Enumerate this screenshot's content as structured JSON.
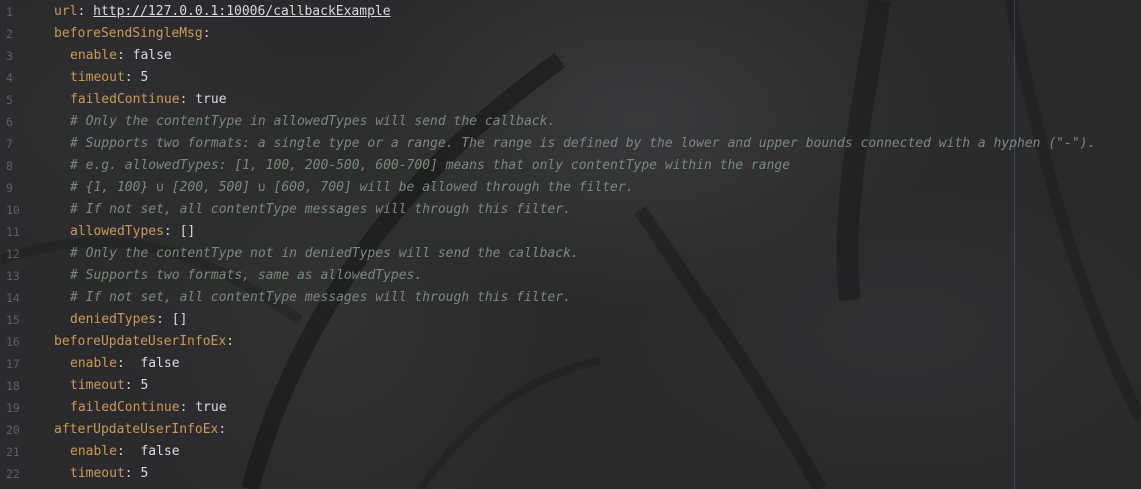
{
  "editor": {
    "language": "yaml",
    "colors": {
      "key": "#cb9a56",
      "comment": "#7a8a7a",
      "value": "#d8dadd",
      "line_number": "#5f6166",
      "background": "#2b2b2d"
    }
  },
  "lines": [
    {
      "n": "1",
      "indent": false,
      "key": "url",
      "value": "http://127.0.0.1:10006/callbackExample",
      "is_url": true
    },
    {
      "n": "2",
      "indent": false,
      "key": "beforeSendSingleMsg",
      "value": ""
    },
    {
      "n": "3",
      "indent": true,
      "key": "enable",
      "value": "false"
    },
    {
      "n": "4",
      "indent": true,
      "key": "timeout",
      "value": "5"
    },
    {
      "n": "5",
      "indent": true,
      "key": "failedContinue",
      "value": "true"
    },
    {
      "n": "6",
      "indent": true,
      "comment": "# Only the contentType in allowedTypes will send the callback."
    },
    {
      "n": "7",
      "indent": true,
      "comment": "# Supports two formats: a single type or a range. The range is defined by the lower and upper bounds connected with a hyphen (\"-\")."
    },
    {
      "n": "8",
      "indent": true,
      "comment": "# e.g. allowedTypes: [1, 100, 200-500, 600-700] means that only contentType within the range"
    },
    {
      "n": "9",
      "indent": true,
      "comment": "# {1, 100} ∪ [200, 500] ∪ [600, 700] will be allowed through the filter."
    },
    {
      "n": "10",
      "indent": true,
      "comment": "# If not set, all contentType messages will through this filter."
    },
    {
      "n": "11",
      "indent": true,
      "key": "allowedTypes",
      "value": "[]"
    },
    {
      "n": "12",
      "indent": true,
      "comment": "# Only the contentType not in deniedTypes will send the callback."
    },
    {
      "n": "13",
      "indent": true,
      "comment": "# Supports two formats, same as allowedTypes."
    },
    {
      "n": "14",
      "indent": true,
      "comment": "# If not set, all contentType messages will through this filter."
    },
    {
      "n": "15",
      "indent": true,
      "key": "deniedTypes",
      "value": "[]"
    },
    {
      "n": "16",
      "indent": false,
      "key": "beforeUpdateUserInfoEx",
      "value": ""
    },
    {
      "n": "17",
      "indent": true,
      "key": "enable",
      "value": " false"
    },
    {
      "n": "18",
      "indent": true,
      "key": "timeout",
      "value": "5"
    },
    {
      "n": "19",
      "indent": true,
      "key": "failedContinue",
      "value": "true"
    },
    {
      "n": "20",
      "indent": false,
      "key": "afterUpdateUserInfoEx",
      "value": ""
    },
    {
      "n": "21",
      "indent": true,
      "key": "enable",
      "value": " false"
    },
    {
      "n": "22",
      "indent": true,
      "key": "timeout",
      "value": "5"
    }
  ]
}
